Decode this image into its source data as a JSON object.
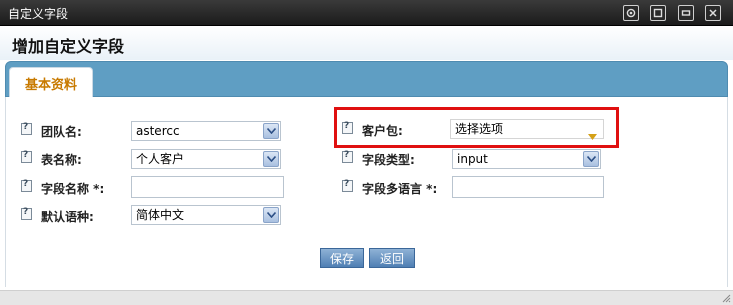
{
  "window": {
    "title": "自定义字段"
  },
  "page": {
    "heading": "增加自定义字段"
  },
  "tabs": [
    {
      "label": "基本资料"
    }
  ],
  "form": {
    "team": {
      "label": "团队名:",
      "value": "astercc"
    },
    "table": {
      "label": "表名称:",
      "value": "个人客户"
    },
    "field_name": {
      "label": "字段名称 *:",
      "value": ""
    },
    "default_language": {
      "label": "默认语种:",
      "value": "简体中文"
    },
    "customer_package": {
      "label": "客户包:",
      "value": "选择选项"
    },
    "field_type": {
      "label": "字段类型:",
      "value": "input"
    },
    "field_multilang": {
      "label": "字段多语言 *:",
      "value": ""
    }
  },
  "buttons": {
    "save": "保存",
    "back": "返回"
  },
  "colors": {
    "tab_bar": "#5f9ec3",
    "tab_label": "#c87a00",
    "highlight": "#e01010",
    "button": "#4f7fb3"
  }
}
